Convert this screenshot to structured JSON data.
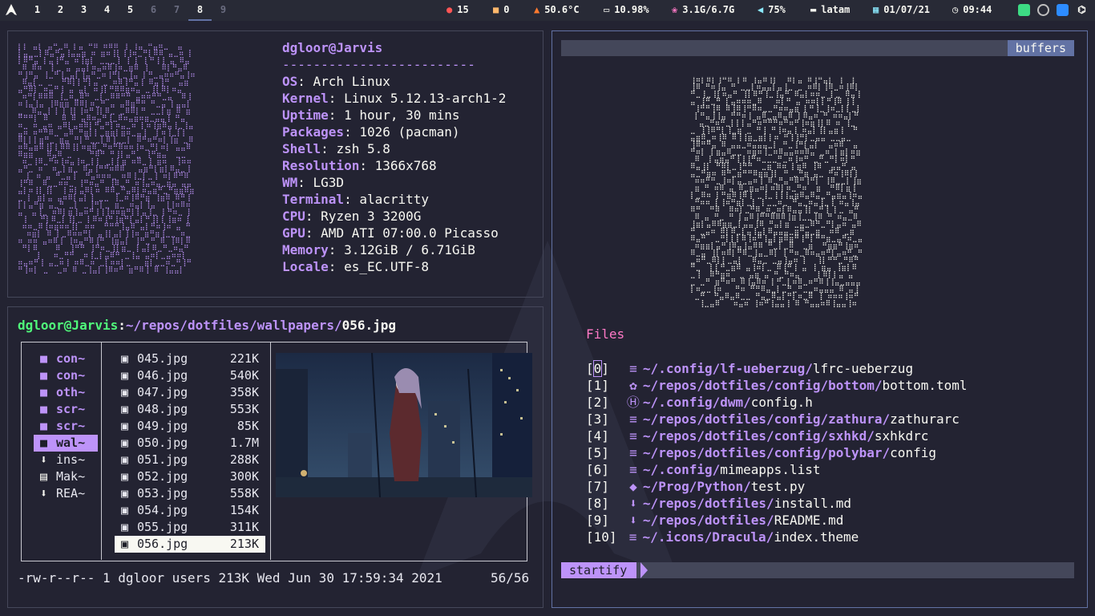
{
  "bar": {
    "workspaces": [
      {
        "label": "1",
        "state": "normal"
      },
      {
        "label": "2",
        "state": "normal"
      },
      {
        "label": "3",
        "state": "normal"
      },
      {
        "label": "4",
        "state": "normal"
      },
      {
        "label": "5",
        "state": "normal"
      },
      {
        "label": "6",
        "state": "dim"
      },
      {
        "label": "7",
        "state": "dim"
      },
      {
        "label": "8",
        "state": "active"
      },
      {
        "label": "9",
        "state": "dim"
      }
    ],
    "modules": {
      "updates": {
        "icon": "tomato-icon",
        "value": "15"
      },
      "aur": {
        "icon": "package-icon",
        "value": "0"
      },
      "temp": {
        "icon": "fire-icon",
        "value": "50.6°C"
      },
      "cpu": {
        "icon": "laptop-icon",
        "value": "10.98%"
      },
      "mem": {
        "icon": "brain-icon",
        "value": "3.1G/6.7G"
      },
      "volume": {
        "icon": "speaker-icon",
        "value": "75%"
      },
      "keyboard": {
        "icon": "keyboard-icon",
        "value": "latam"
      },
      "date": {
        "icon": "calendar-icon",
        "value": "01/07/21"
      },
      "time": {
        "icon": "clock-icon",
        "value": "09:44"
      }
    },
    "tray": [
      "android-icon",
      "whatsapp-icon",
      "zoom-icon",
      "network-icon"
    ]
  },
  "neofetch": {
    "user": "dgloor@Jarvis",
    "separator": "-------------------------",
    "info": [
      {
        "key": "OS",
        "val": "Arch Linux"
      },
      {
        "key": "Kernel",
        "val": "Linux 5.12.13-arch1-2"
      },
      {
        "key": "Uptime",
        "val": "1 hour, 30 mins"
      },
      {
        "key": "Packages",
        "val": "1026 (pacman)"
      },
      {
        "key": "Shell",
        "val": "zsh 5.8"
      },
      {
        "key": "Resolution",
        "val": "1366x768"
      },
      {
        "key": "WM",
        "val": "LG3D"
      },
      {
        "key": "Terminal",
        "val": "alacritty"
      },
      {
        "key": "CPU",
        "val": "Ryzen 3 3200G"
      },
      {
        "key": "GPU",
        "val": "AMD ATI 07:00.0 Picasso"
      },
      {
        "key": "Memory",
        "val": "3.12GiB / 6.71GiB"
      },
      {
        "key": "Locale",
        "val": "es_EC.UTF-8"
      }
    ]
  },
  "lf": {
    "header": {
      "user": "dgloor@Jarvis",
      "sep": ":",
      "path": "~/repos/dotfiles/wallpapers/",
      "file": "056.jpg"
    },
    "parent": [
      {
        "icon": "folder-icon",
        "name": "con~",
        "dir": true
      },
      {
        "icon": "folder-icon",
        "name": "con~",
        "dir": true
      },
      {
        "icon": "folder-icon",
        "name": "oth~",
        "dir": true
      },
      {
        "icon": "folder-icon",
        "name": "scr~",
        "dir": true
      },
      {
        "icon": "folder-icon",
        "name": "scr~",
        "dir": true
      },
      {
        "icon": "folder-icon",
        "name": "wal~",
        "dir": true,
        "selected": true
      },
      {
        "icon": "download-icon",
        "name": "ins~",
        "dir": false
      },
      {
        "icon": "document-icon",
        "name": "Mak~",
        "dir": false
      },
      {
        "icon": "download-icon",
        "name": "REA~",
        "dir": false
      }
    ],
    "files": [
      {
        "name": "045.jpg",
        "size": "221K"
      },
      {
        "name": "046.jpg",
        "size": "540K"
      },
      {
        "name": "047.jpg",
        "size": "358K"
      },
      {
        "name": "048.jpg",
        "size": "553K"
      },
      {
        "name": "049.jpg",
        "size": "85K"
      },
      {
        "name": "050.jpg",
        "size": "1.7M"
      },
      {
        "name": "051.jpg",
        "size": "288K"
      },
      {
        "name": "052.jpg",
        "size": "300K"
      },
      {
        "name": "053.jpg",
        "size": "558K"
      },
      {
        "name": "054.jpg",
        "size": "154K"
      },
      {
        "name": "055.jpg",
        "size": "311K"
      },
      {
        "name": "056.jpg",
        "size": "213K",
        "selected": true
      }
    ],
    "status": {
      "info": "-rw-r--r-- 1 dgloor users 213K Wed Jun 30 17:59:34 2021",
      "pos": "56/56"
    }
  },
  "nvim": {
    "tab_label": "buffers",
    "files_heading": "Files",
    "mru": [
      {
        "idx": "0",
        "icon": "text-icon",
        "path": "~/.config/lf-ueberzug/",
        "file": "lfrc-ueberzug"
      },
      {
        "idx": "1",
        "icon": "gear-icon",
        "path": "~/repos/dotfiles/config/bottom/",
        "file": "bottom.toml"
      },
      {
        "idx": "2",
        "icon": "h-file-icon",
        "path": "~/.config/dwm/",
        "file": "config.h"
      },
      {
        "idx": "3",
        "icon": "text-icon",
        "path": "~/repos/dotfiles/config/zathura/",
        "file": "zathurarc"
      },
      {
        "idx": "4",
        "icon": "text-icon",
        "path": "~/repos/dotfiles/config/sxhkd/",
        "file": "sxhkdrc"
      },
      {
        "idx": "5",
        "icon": "text-icon",
        "path": "~/repos/dotfiles/config/polybar/",
        "file": "config"
      },
      {
        "idx": "6",
        "icon": "text-icon",
        "path": "~/.config/",
        "file": "mimeapps.list"
      },
      {
        "idx": "7",
        "icon": "python-icon",
        "path": "~/Prog/Python/",
        "file": "test.py"
      },
      {
        "idx": "8",
        "icon": "download-icon",
        "path": "~/repos/dotfiles/",
        "file": "install.md"
      },
      {
        "idx": "9",
        "icon": "download-icon",
        "path": "~/repos/dotfiles/",
        "file": "README.md"
      },
      {
        "idx": "10",
        "icon": "text-icon",
        "path": "~/.icons/Dracula/",
        "file": "index.theme"
      }
    ],
    "mode": "startify"
  },
  "colors": {
    "accent": "#bd93f9",
    "bg": "#232332",
    "bar": "#282a36",
    "pink": "#ff79c6",
    "green": "#50fa7b",
    "blue": "#6272a4"
  }
}
